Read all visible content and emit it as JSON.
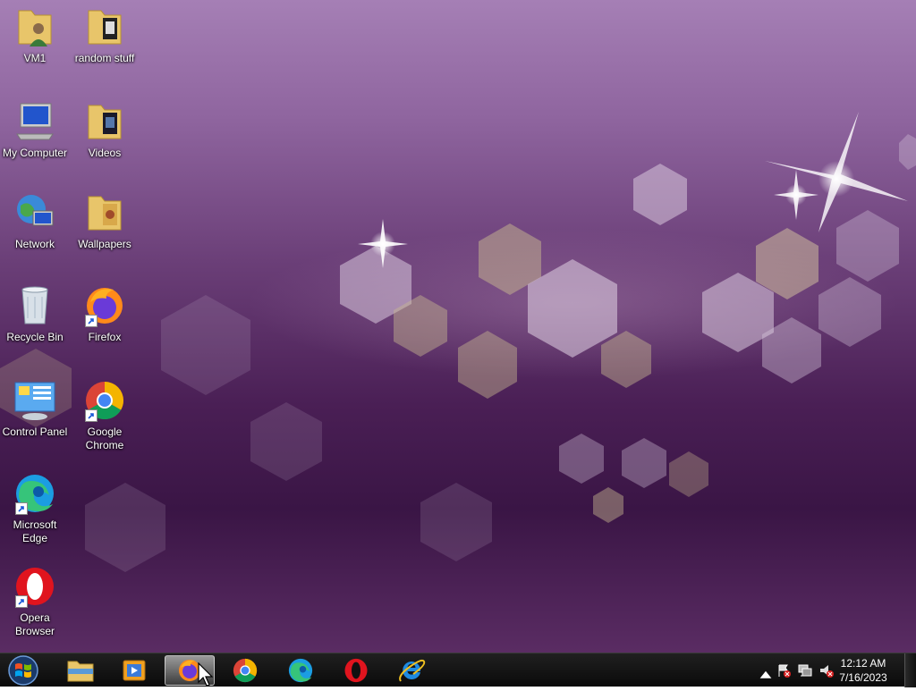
{
  "desktop_icons": [
    {
      "id": "vm1",
      "label": "VM1",
      "icon": "user-folder-icon"
    },
    {
      "id": "random",
      "label": "random stuff",
      "icon": "folder-icon"
    },
    {
      "id": "mycomputer",
      "label": "My Computer",
      "icon": "computer-icon"
    },
    {
      "id": "videos",
      "label": "Videos",
      "icon": "folder-icon"
    },
    {
      "id": "network",
      "label": "Network",
      "icon": "network-globe-icon"
    },
    {
      "id": "wallpapers",
      "label": "Wallpapers",
      "icon": "folder-icon"
    },
    {
      "id": "recycle",
      "label": "Recycle Bin",
      "icon": "recycle-bin-icon"
    },
    {
      "id": "firefox",
      "label": "Firefox",
      "icon": "firefox-icon"
    },
    {
      "id": "controlpanel",
      "label": "Control Panel",
      "icon": "control-panel-icon"
    },
    {
      "id": "chrome",
      "label": "Google Chrome",
      "icon": "chrome-icon"
    },
    {
      "id": "edge",
      "label": "Microsoft Edge",
      "icon": "edge-icon"
    },
    {
      "id": "opera",
      "label": "Opera Browser",
      "icon": "opera-icon"
    }
  ],
  "taskbar": {
    "pinned": [
      {
        "name": "file-explorer",
        "icon": "folder-icon",
        "active": false
      },
      {
        "name": "media-player",
        "icon": "media-player-icon",
        "active": false
      },
      {
        "name": "firefox",
        "icon": "firefox-icon",
        "active": true
      },
      {
        "name": "chrome",
        "icon": "chrome-icon",
        "active": false
      },
      {
        "name": "edge",
        "icon": "edge-icon",
        "active": false
      },
      {
        "name": "opera",
        "icon": "opera-icon",
        "active": false
      },
      {
        "name": "internet-explorer",
        "icon": "ie-icon",
        "active": false
      }
    ]
  },
  "tray": {
    "icons": [
      "show-hidden-icons-arrow",
      "action-center-flag-icon",
      "network-icon",
      "volume-muted-icon"
    ],
    "time": "12:12 AM",
    "date": "7/16/2023"
  },
  "colors": {
    "wallpaper_top": "#a57fb5",
    "wallpaper_bottom": "#3a1545",
    "taskbar": "#111111"
  }
}
